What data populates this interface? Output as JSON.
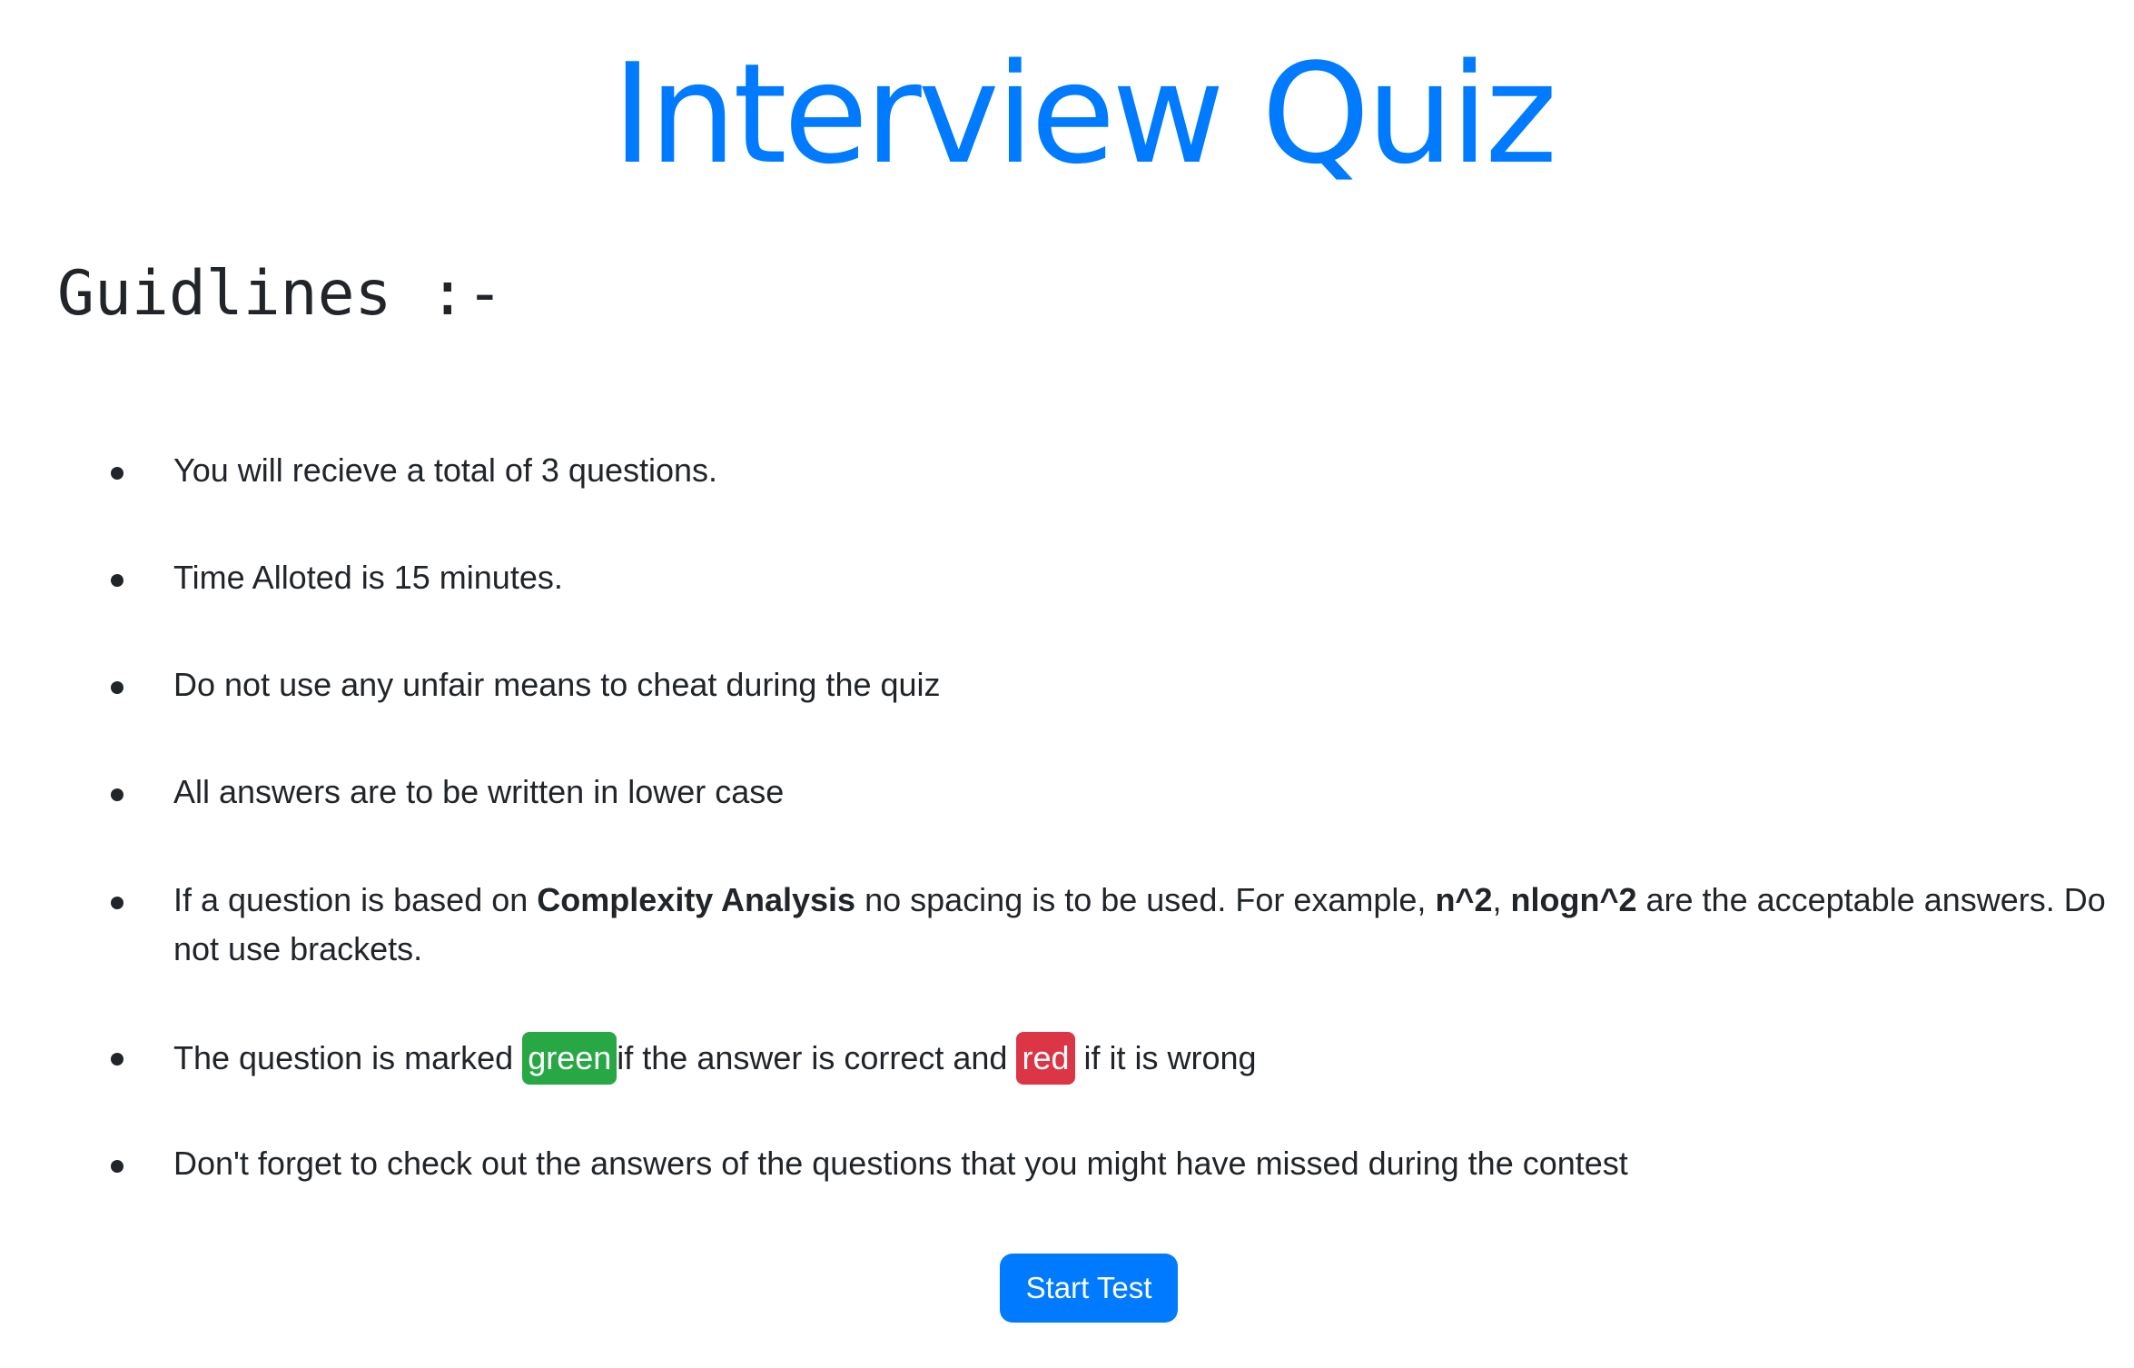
{
  "header": {
    "title": "Interview Quiz"
  },
  "guidelines": {
    "heading": "Guidlines :-",
    "rules": [
      {
        "text": "You will recieve a total of 3 questions."
      },
      {
        "text": "Time Alloted is 15 minutes."
      },
      {
        "text": "Do not use any unfair means to cheat during the quiz"
      },
      {
        "text": "All answers are to be written in lower case"
      },
      {
        "part1": "If a question is based on ",
        "bold1": "Complexity Analysis",
        "part2": " no spacing is to be used. For example, ",
        "bold2": "n^2",
        "part3": ", ",
        "bold3": "nlogn^2",
        "part4": " are the acceptable answers. Do not use brackets."
      },
      {
        "part1": "The question is marked ",
        "badge_green": "green",
        "part2": "if the answer is correct and ",
        "badge_red": "red",
        "part3": " if it is wrong"
      },
      {
        "text": "Don't forget to check out the answers of the questions that you might have missed during the contest"
      }
    ]
  },
  "actions": {
    "start_label": "Start Test"
  },
  "colors": {
    "primary": "#007bff",
    "success": "#28a745",
    "danger": "#dc3545",
    "text": "#212529"
  }
}
